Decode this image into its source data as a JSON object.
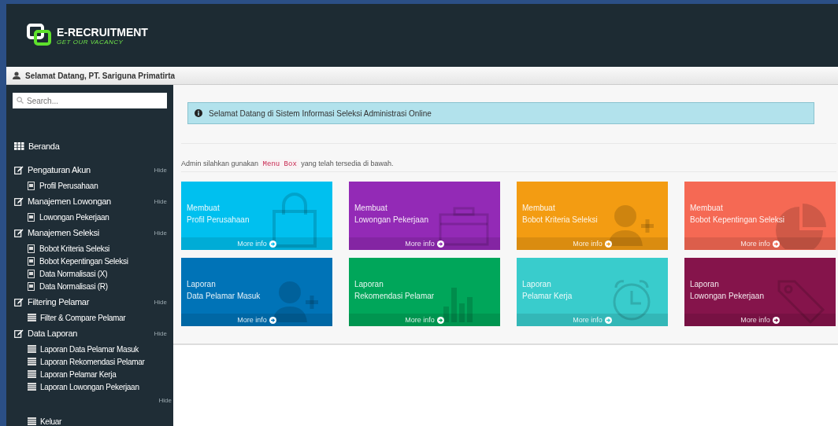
{
  "brand": {
    "title": "E-RECRUITMENT",
    "tagline": "GET OUR VACANCY"
  },
  "welcome_bar": {
    "text": "Selamat Datang, PT. Sariguna Primatirta"
  },
  "sidebar": {
    "search": {
      "placeholder": "Search..."
    },
    "items": [
      {
        "kind": "home",
        "label": "Beranda"
      },
      {
        "kind": "section",
        "label": "Pengaturan Akun",
        "toggle": "Hide",
        "children": [
          {
            "kind": "page",
            "label": "Profil Perusahaan"
          }
        ]
      },
      {
        "kind": "section",
        "label": "Manajemen Lowongan",
        "toggle": "Hide",
        "children": [
          {
            "kind": "page",
            "label": "Lowongan Pekerjaan"
          }
        ]
      },
      {
        "kind": "section",
        "label": "Manajemen Seleksi",
        "toggle": "Hide",
        "children": [
          {
            "kind": "page",
            "label": "Bobot Kriteria Seleksi"
          },
          {
            "kind": "page",
            "label": "Bobot Kepentingan Seleksi"
          },
          {
            "kind": "page",
            "label": "Data Normalisasi (X)"
          },
          {
            "kind": "page",
            "label": "Data Normalisasi (R)"
          }
        ]
      },
      {
        "kind": "section",
        "label": "Filtering Pelamar",
        "toggle": "Hide",
        "children": [
          {
            "kind": "list",
            "label": "Filter & Compare Pelamar"
          }
        ]
      },
      {
        "kind": "section",
        "label": "Data Laporan",
        "toggle": "Hide",
        "children": [
          {
            "kind": "list",
            "label": "Laporan Data Pelamar Masuk"
          },
          {
            "kind": "list",
            "label": "Laporan Rekomendasi Pelamar"
          },
          {
            "kind": "list",
            "label": "Laporan Pelamar Kerja"
          },
          {
            "kind": "list",
            "label": "Laporan Lowongan Pekerjaan"
          }
        ]
      }
    ],
    "footer": {
      "toggle": "Hide",
      "item": {
        "kind": "list",
        "label": "Keluar"
      }
    }
  },
  "alert": {
    "text": "Selamat Datang di Sistem Informasi Seleksi Administrasi Online"
  },
  "intro": {
    "before": "Admin silahkan gunakan",
    "code": "Menu Box",
    "after": "yang telah tersedia di bawah."
  },
  "boxes": [
    {
      "line1": "Membuat",
      "line2": "Profil Perusahaan",
      "link": "More info",
      "color": "#00c0ef"
    },
    {
      "line1": "Membuat",
      "line2": "Lowongan Pekerjaan",
      "link": "More info",
      "color": "#932ab6"
    },
    {
      "line1": "Membuat",
      "line2": "Bobot Kriteria Seleksi",
      "link": "More info",
      "color": "#f39c12"
    },
    {
      "line1": "Membuat",
      "line2": "Bobot Kepentingan Seleksi",
      "link": "More info",
      "color": "#f56954"
    },
    {
      "line1": "Laporan",
      "line2": "Data Pelamar Masuk",
      "link": "More info",
      "color": "#0073b7"
    },
    {
      "line1": "Laporan",
      "line2": "Rekomendasi Pelamar",
      "link": "More info",
      "color": "#00a65a"
    },
    {
      "line1": "Laporan",
      "line2": "Pelamar Kerja",
      "link": "More info",
      "color": "#39cccc"
    },
    {
      "line1": "Laporan",
      "line2": "Lowongan Pekerjaan",
      "link": "More info",
      "color": "#85144b"
    }
  ]
}
